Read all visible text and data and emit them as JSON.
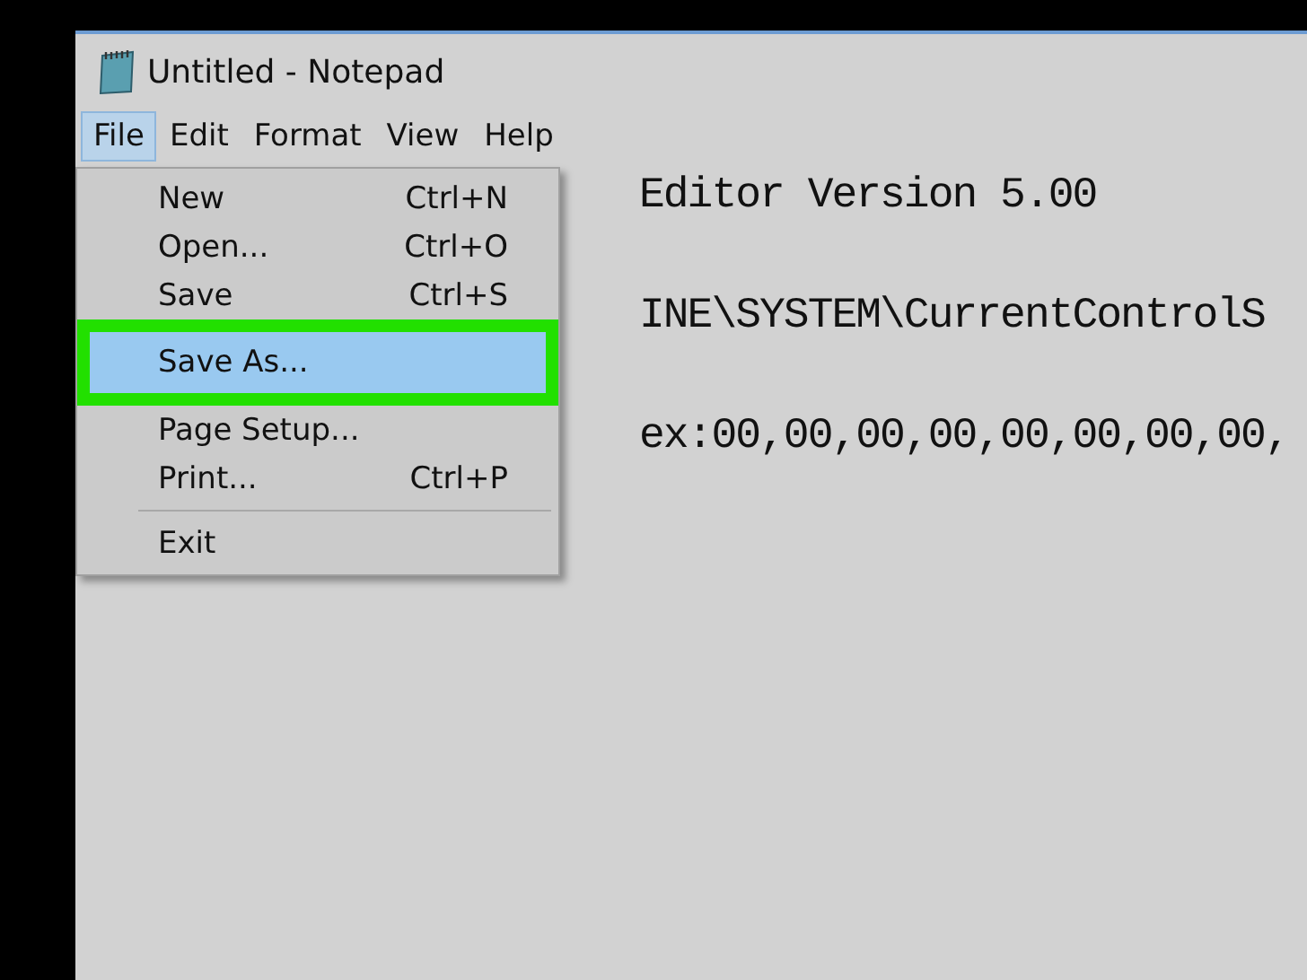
{
  "window": {
    "title": "Untitled - Notepad"
  },
  "menu_bar": [
    {
      "label": "File",
      "selected": true
    },
    {
      "label": "Edit",
      "selected": false
    },
    {
      "label": "Format",
      "selected": false
    },
    {
      "label": "View",
      "selected": false
    },
    {
      "label": "Help",
      "selected": false
    }
  ],
  "file_menu": [
    {
      "kind": "item",
      "label": "New",
      "shortcut": "Ctrl+N",
      "selected": false
    },
    {
      "kind": "item",
      "label": "Open...",
      "shortcut": "Ctrl+O",
      "selected": false
    },
    {
      "kind": "item",
      "label": "Save",
      "shortcut": "Ctrl+S",
      "selected": false
    },
    {
      "kind": "item",
      "label": "Save As...",
      "selected": true
    },
    {
      "kind": "item",
      "label": "Page Setup...",
      "selected": false
    },
    {
      "kind": "item",
      "label": "Print...",
      "shortcut": "Ctrl+P",
      "selected": false
    },
    {
      "kind": "separator"
    },
    {
      "kind": "item",
      "label": "Exit",
      "selected": false
    }
  ],
  "editor": {
    "lines": [
      "Editor Version 5.00",
      "INE\\SYSTEM\\CurrentControlS",
      "ex:00,00,00,00,00,00,00,00,"
    ]
  }
}
